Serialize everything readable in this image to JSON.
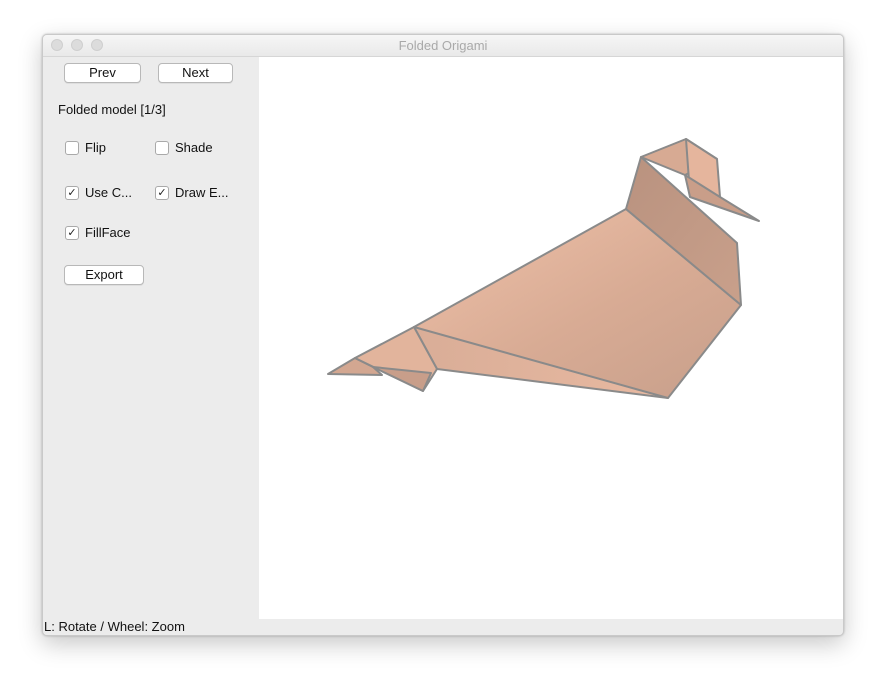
{
  "window": {
    "title": "Folded Origami"
  },
  "sidebar": {
    "prev_label": "Prev",
    "next_label": "Next",
    "model_label": "Folded model [1/3]",
    "checkboxes": [
      {
        "label": "Flip",
        "checked": false
      },
      {
        "label": "Shade",
        "checked": false
      },
      {
        "label": "Use C...",
        "checked": true
      },
      {
        "label": "Draw E...",
        "checked": true
      },
      {
        "label": "FillFace",
        "checked": true
      }
    ],
    "export_label": "Export"
  },
  "status": {
    "text": "L: Rotate / Wheel: Zoom"
  },
  "colors": {
    "face_light": "#ebbba3",
    "face_dark": "#c39c88",
    "edge": "#8a8a8a"
  }
}
